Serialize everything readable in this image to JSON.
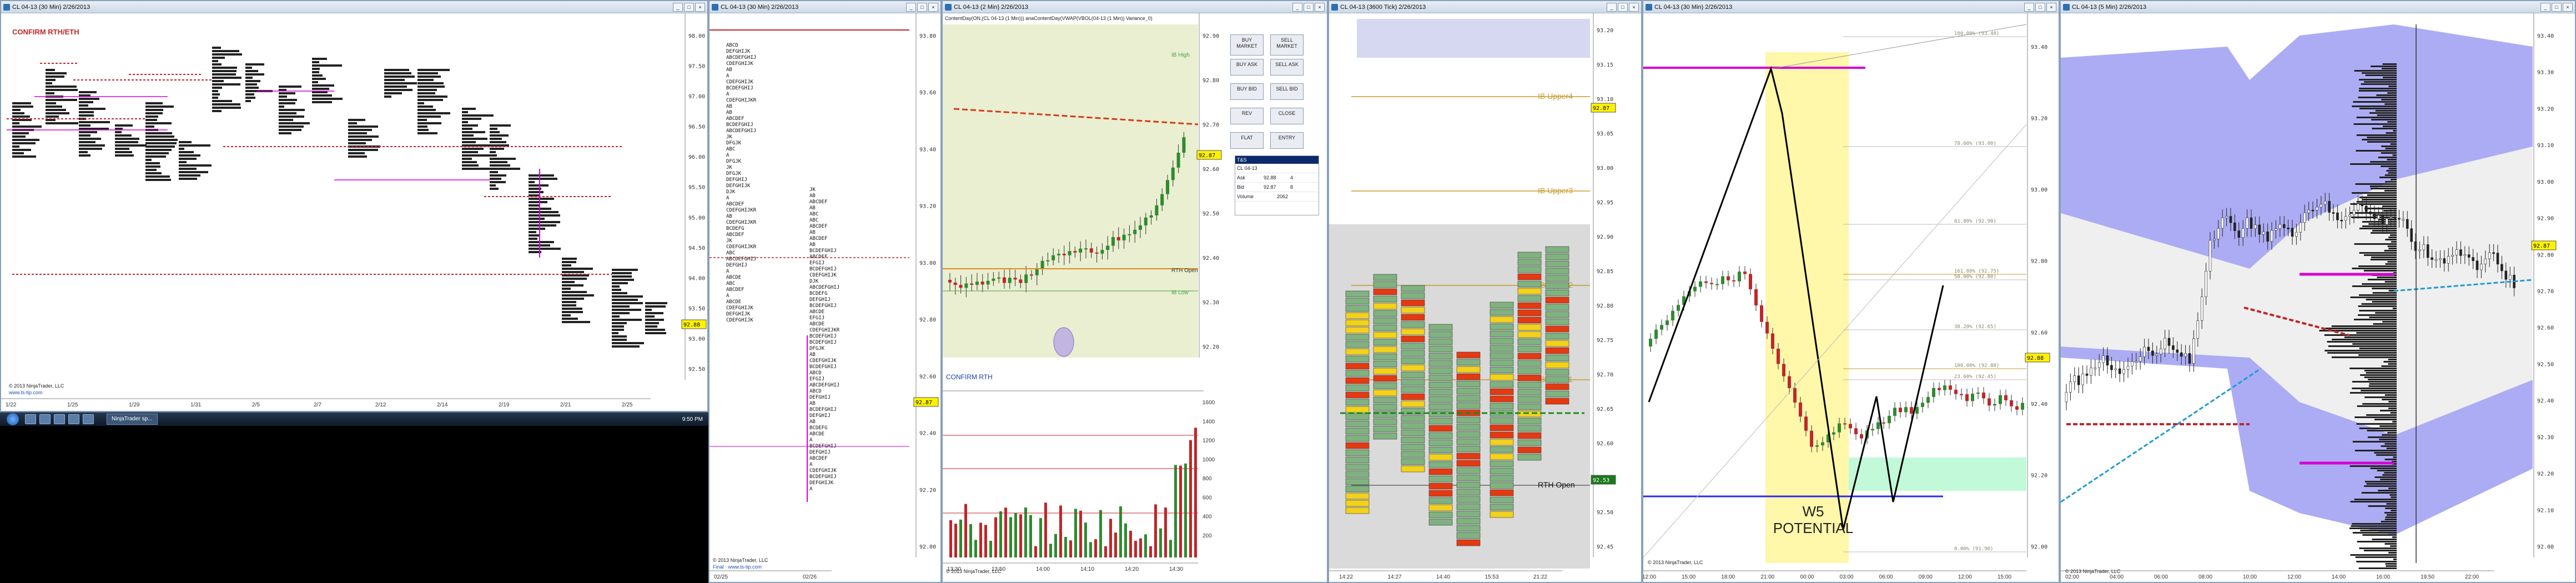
{
  "windows": [
    {
      "id": "w1",
      "title": "CL 04-13 (30 Min) 2/26/2013",
      "label": "CONFIRM RTH/ETH",
      "x_labels": [
        "1/22",
        "1/25",
        "1/29",
        "1/31",
        "2/5",
        "2/7",
        "2/12",
        "2/14",
        "2/19",
        "2/21",
        "2/25"
      ],
      "prices": [
        "98.00",
        "97.50",
        "97.00",
        "96.50",
        "96.00",
        "95.50",
        "95.00",
        "94.50",
        "94.00",
        "93.50",
        "93.00",
        "92.50"
      ],
      "current_price": "92.88",
      "copyright": "© 2013 NinjaTrader, LLC",
      "link": "www.ts-tip.com"
    },
    {
      "id": "w2",
      "title": "CL 04-13 (30 Min) 2/26/2013",
      "prices": [
        "93.80",
        "93.60",
        "93.40",
        "93.20",
        "93.00",
        "92.80",
        "92.60",
        "92.40",
        "92.20",
        "92.00"
      ],
      "current_price": "92.87",
      "x_labels": [
        "02/25",
        "02/26"
      ],
      "copyright": "© 2013 NinjaTrader, LLC",
      "link": "Final · www.ts-tip.com"
    },
    {
      "id": "w3",
      "title": "CL 04-13 (2 Min) 2/26/2013",
      "subtitle": "ContentDay(ON,(CL 04-13 (1 Min))) anaContentDay(VWAP(VBOL(04-13 (1 Min)) Variance_0)",
      "label": "CONFIRM RTH",
      "hi_label": "IB High",
      "lo_label": "IB Low",
      "rth_label": "RTH Open",
      "prices": [
        "92.90",
        "92.80",
        "92.70",
        "92.60",
        "92.50",
        "92.40",
        "92.30",
        "92.20"
      ],
      "x_labels": [
        "13:30",
        "13:50",
        "14:00",
        "14:10",
        "14:20",
        "14:30"
      ],
      "vol_labels": [
        "1600",
        "1400",
        "1200",
        "1000",
        "800",
        "600",
        "400",
        "200"
      ],
      "current_price": "92.87",
      "copyright": "© 2013 NinjaTrader, LLC"
    },
    {
      "id": "w4",
      "title": "CL 04-13 (3600 Tick) 2/26/2013",
      "levels": [
        "IB Upper4",
        "IB Upper3",
        "IB Upper2",
        "IB Upper1",
        "RTH Open"
      ],
      "prices": [
        "93.20",
        "93.15",
        "93.10",
        "93.05",
        "93.00",
        "92.95",
        "92.90",
        "92.85",
        "92.80",
        "92.75",
        "92.70",
        "92.65",
        "92.60",
        "92.55",
        "92.50",
        "92.45"
      ],
      "x_labels": [
        "14:22",
        "14:27",
        "14:40",
        "15:53",
        "21:22"
      ],
      "current_price": "92.87",
      "tag_price": "92.53"
    },
    {
      "id": "w5",
      "title": "CL 04-13 (30 Min) 2/26/2013",
      "fib_labels": [
        "100.00% (93.40)",
        "78.60% (93.00)",
        "61.80% (92.90)",
        "50.00% (92.80)",
        "38.20% (92.65)",
        "23.60% (92.45)",
        "0.00% (91.90)",
        "161.80% (92.75)",
        "100.00% (92.88)"
      ],
      "annotation_1": "W5",
      "annotation_2": "POTENTIAL",
      "prices": [
        "93.40",
        "93.20",
        "93.00",
        "92.80",
        "92.60",
        "92.40",
        "92.20",
        "92.00"
      ],
      "x_labels": [
        "12:00",
        "15:00",
        "18:00",
        "21:00",
        "00:00",
        "03:00",
        "06:00",
        "09:00",
        "12:00",
        "15:00"
      ],
      "current_price": "92.88",
      "copyright": "© 2013 NinjaTrader, LLC"
    },
    {
      "id": "w6",
      "title": "CL 04-13 (5 Min) 2/26/2013",
      "prices": [
        "93.40",
        "93.30",
        "93.20",
        "93.10",
        "93.00",
        "92.90",
        "92.80",
        "92.70",
        "92.60",
        "92.50",
        "92.40",
        "92.30",
        "92.20",
        "92.10",
        "92.00"
      ],
      "x_labels": [
        "02:00",
        "04:00",
        "06:00",
        "08:00",
        "10:00",
        "12:00",
        "14:00",
        "16:00",
        "19:50",
        "22:00"
      ],
      "current_price": "92.87",
      "copyright": "© 2013 NinjaTrader, LLC"
    }
  ],
  "trade_buttons": [
    "BUY MARKET",
    "SELL MARKET",
    "BUY ASK",
    "SELL ASK",
    "BUY BID",
    "SELL BID",
    "REV",
    "CLOSE",
    "FLAT",
    "ENTRY"
  ],
  "time_and_sales": {
    "title": "T&S",
    "instrument": "CL 04-13",
    "rows": [
      {
        "label": "Ask",
        "price": "92.88",
        "size": "4"
      },
      {
        "label": "Bid",
        "price": "92.87",
        "size": "8"
      }
    ],
    "volume_label": "Volume",
    "volume": "2062"
  },
  "taskbar": {
    "app": "NinjaTrader sp...",
    "clock": "9:50 PM"
  },
  "colors": {
    "buy": "#2e8b2e",
    "sell": "#c0262a",
    "ib": "#c89a2a",
    "magenta": "#d600d6",
    "vwap": "#1c9ad6",
    "band": "#9d9df2",
    "hl": "#fff69a"
  }
}
